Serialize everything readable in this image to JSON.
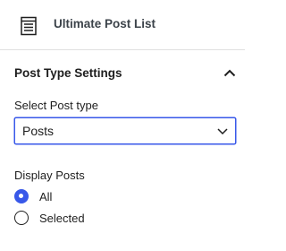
{
  "block": {
    "title": "Ultimate Post List",
    "icon": "list-layout-icon"
  },
  "panel": {
    "title": "Post Type Settings",
    "toggle_icon": "chevron-up-icon"
  },
  "post_type": {
    "label": "Select Post type",
    "value": "Posts",
    "icon": "chevron-down-icon"
  },
  "display_posts": {
    "label": "Display Posts",
    "options": [
      {
        "label": "All",
        "checked": true
      },
      {
        "label": "Selected",
        "checked": false
      }
    ]
  },
  "colors": {
    "accent": "#3858e9",
    "text": "#1e1e1e",
    "muted_text": "#3c434a",
    "divider": "#e0e0e0"
  }
}
